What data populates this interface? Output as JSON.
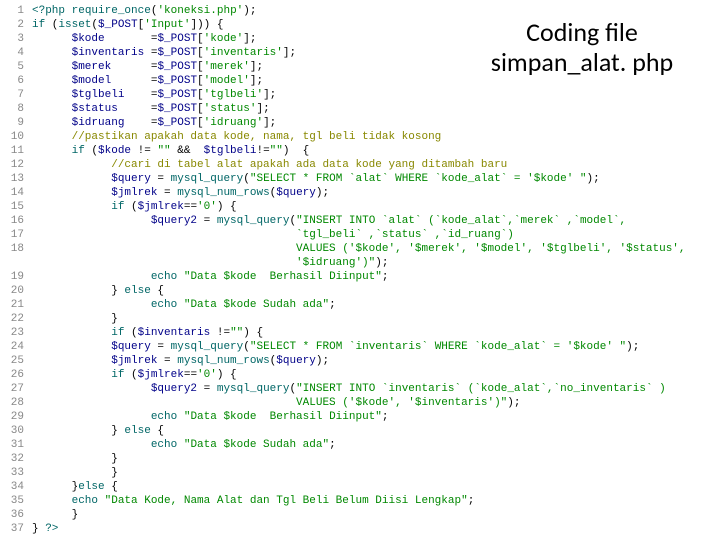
{
  "title": {
    "line1": "Coding file",
    "line2": "simpan_alat. php"
  },
  "lines": [
    {
      "n": "1",
      "html": "<span class='kw'>&lt;?php</span> <span class='kw'>require_once</span>(<span class='str'>'koneksi.php'</span>);"
    },
    {
      "n": "2",
      "html": "<span class='kw'>if</span> (<span class='kw'>isset</span>(<span class='var'>$_POST</span>[<span class='str'>'Input'</span>])) {"
    },
    {
      "n": "3",
      "html": "      <span class='var'>$kode</span>       =<span class='var'>$_POST</span>[<span class='str'>'kode'</span>];"
    },
    {
      "n": "4",
      "html": "      <span class='var'>$inventaris</span> =<span class='var'>$_POST</span>[<span class='str'>'inventaris'</span>];"
    },
    {
      "n": "5",
      "html": "      <span class='var'>$merek</span>      =<span class='var'>$_POST</span>[<span class='str'>'merek'</span>];"
    },
    {
      "n": "6",
      "html": "      <span class='var'>$model</span>      =<span class='var'>$_POST</span>[<span class='str'>'model'</span>];"
    },
    {
      "n": "7",
      "html": "      <span class='var'>$tglbeli</span>    =<span class='var'>$_POST</span>[<span class='str'>'tglbeli'</span>];"
    },
    {
      "n": "8",
      "html": "      <span class='var'>$status</span>     =<span class='var'>$_POST</span>[<span class='str'>'status'</span>];"
    },
    {
      "n": "9",
      "html": "      <span class='var'>$idruang</span>    =<span class='var'>$_POST</span>[<span class='str'>'idruang'</span>];"
    },
    {
      "n": "10",
      "html": "      <span class='cm'>//pastikan apakah data kode, nama, tgl beli tidak kosong</span>"
    },
    {
      "n": "11",
      "html": "      <span class='kw'>if</span> (<span class='var'>$kode</span> != <span class='str'>\"\"</span> &amp;&amp;  <span class='var'>$tglbeli</span>!=<span class='str'>\"\"</span>)  {"
    },
    {
      "n": "12",
      "html": "            <span class='cm'>//cari di tabel alat apakah ada data kode yang ditambah baru</span>"
    },
    {
      "n": "13",
      "html": "            <span class='var'>$query</span> = <span class='kw'>mysql_query</span>(<span class='str'>\"SELECT * FROM `alat` WHERE `kode_alat` = '$kode' \"</span>);"
    },
    {
      "n": "14",
      "html": "            <span class='var'>$jmlrek</span> = <span class='kw'>mysql_num_rows</span>(<span class='var'>$query</span>);"
    },
    {
      "n": "15",
      "html": "            <span class='kw'>if</span> (<span class='var'>$jmlrek</span>==<span class='str'>'0'</span>) {"
    },
    {
      "n": "16",
      "html": "                  <span class='var'>$query2</span> = <span class='kw'>mysql_query</span>(<span class='str'>\"INSERT INTO `alat` (`kode_alat`,`merek` ,`model`,</span>"
    },
    {
      "n": "17",
      "html": "                                        <span class='str'>`tgl_beli` ,`status` ,`id_ruang`)</span>"
    },
    {
      "n": "18",
      "html": "                                        <span class='str'>VALUES ('$kode', '$merek', '$model', '$tglbeli', '$status',</span>"
    },
    {
      "n": "",
      "html": "                                        <span class='str'>'$idruang')\"</span>);"
    },
    {
      "n": "19",
      "html": "                  <span class='kw'>echo</span> <span class='str'>\"Data $kode  Berhasil Diinput\"</span>;"
    },
    {
      "n": "20",
      "html": "            } <span class='kw'>else</span> {"
    },
    {
      "n": "21",
      "html": "                  <span class='kw'>echo</span> <span class='str'>\"Data $kode Sudah ada\"</span>;"
    },
    {
      "n": "22",
      "html": "            }"
    },
    {
      "n": "23",
      "html": "            <span class='kw'>if</span> (<span class='var'>$inventaris</span> !=<span class='str'>\"\"</span>) {"
    },
    {
      "n": "24",
      "html": "            <span class='var'>$query</span> = <span class='kw'>mysql_query</span>(<span class='str'>\"SELECT * FROM `inventaris` WHERE `kode_alat` = '$kode' \"</span>);"
    },
    {
      "n": "25",
      "html": "            <span class='var'>$jmlrek</span> = <span class='kw'>mysql_num_rows</span>(<span class='var'>$query</span>);"
    },
    {
      "n": "26",
      "html": "            <span class='kw'>if</span> (<span class='var'>$jmlrek</span>==<span class='str'>'0'</span>) {"
    },
    {
      "n": "27",
      "html": "                  <span class='var'>$query2</span> = <span class='kw'>mysql_query</span>(<span class='str'>\"INSERT INTO `inventaris` (`kode_alat`,`no_inventaris` )</span>"
    },
    {
      "n": "28",
      "html": "                                        <span class='str'>VALUES ('$kode', '$inventaris')\"</span>);"
    },
    {
      "n": "29",
      "html": "                  <span class='kw'>echo</span> <span class='str'>\"Data $kode  Berhasil Diinput\"</span>;"
    },
    {
      "n": "30",
      "html": "            } <span class='kw'>else</span> {"
    },
    {
      "n": "31",
      "html": "                  <span class='kw'>echo</span> <span class='str'>\"Data $kode Sudah ada\"</span>;"
    },
    {
      "n": "32",
      "html": "            }"
    },
    {
      "n": "33",
      "html": "            }"
    },
    {
      "n": "34",
      "html": "      }<span class='kw'>else</span> {"
    },
    {
      "n": "35",
      "html": "      <span class='kw'>echo</span> <span class='str'>\"Data Kode, Nama Alat dan Tgl Beli Belum Diisi Lengkap\"</span>;"
    },
    {
      "n": "36",
      "html": "      }"
    },
    {
      "n": "37",
      "html": "} <span class='kw'>?&gt;</span>"
    }
  ]
}
